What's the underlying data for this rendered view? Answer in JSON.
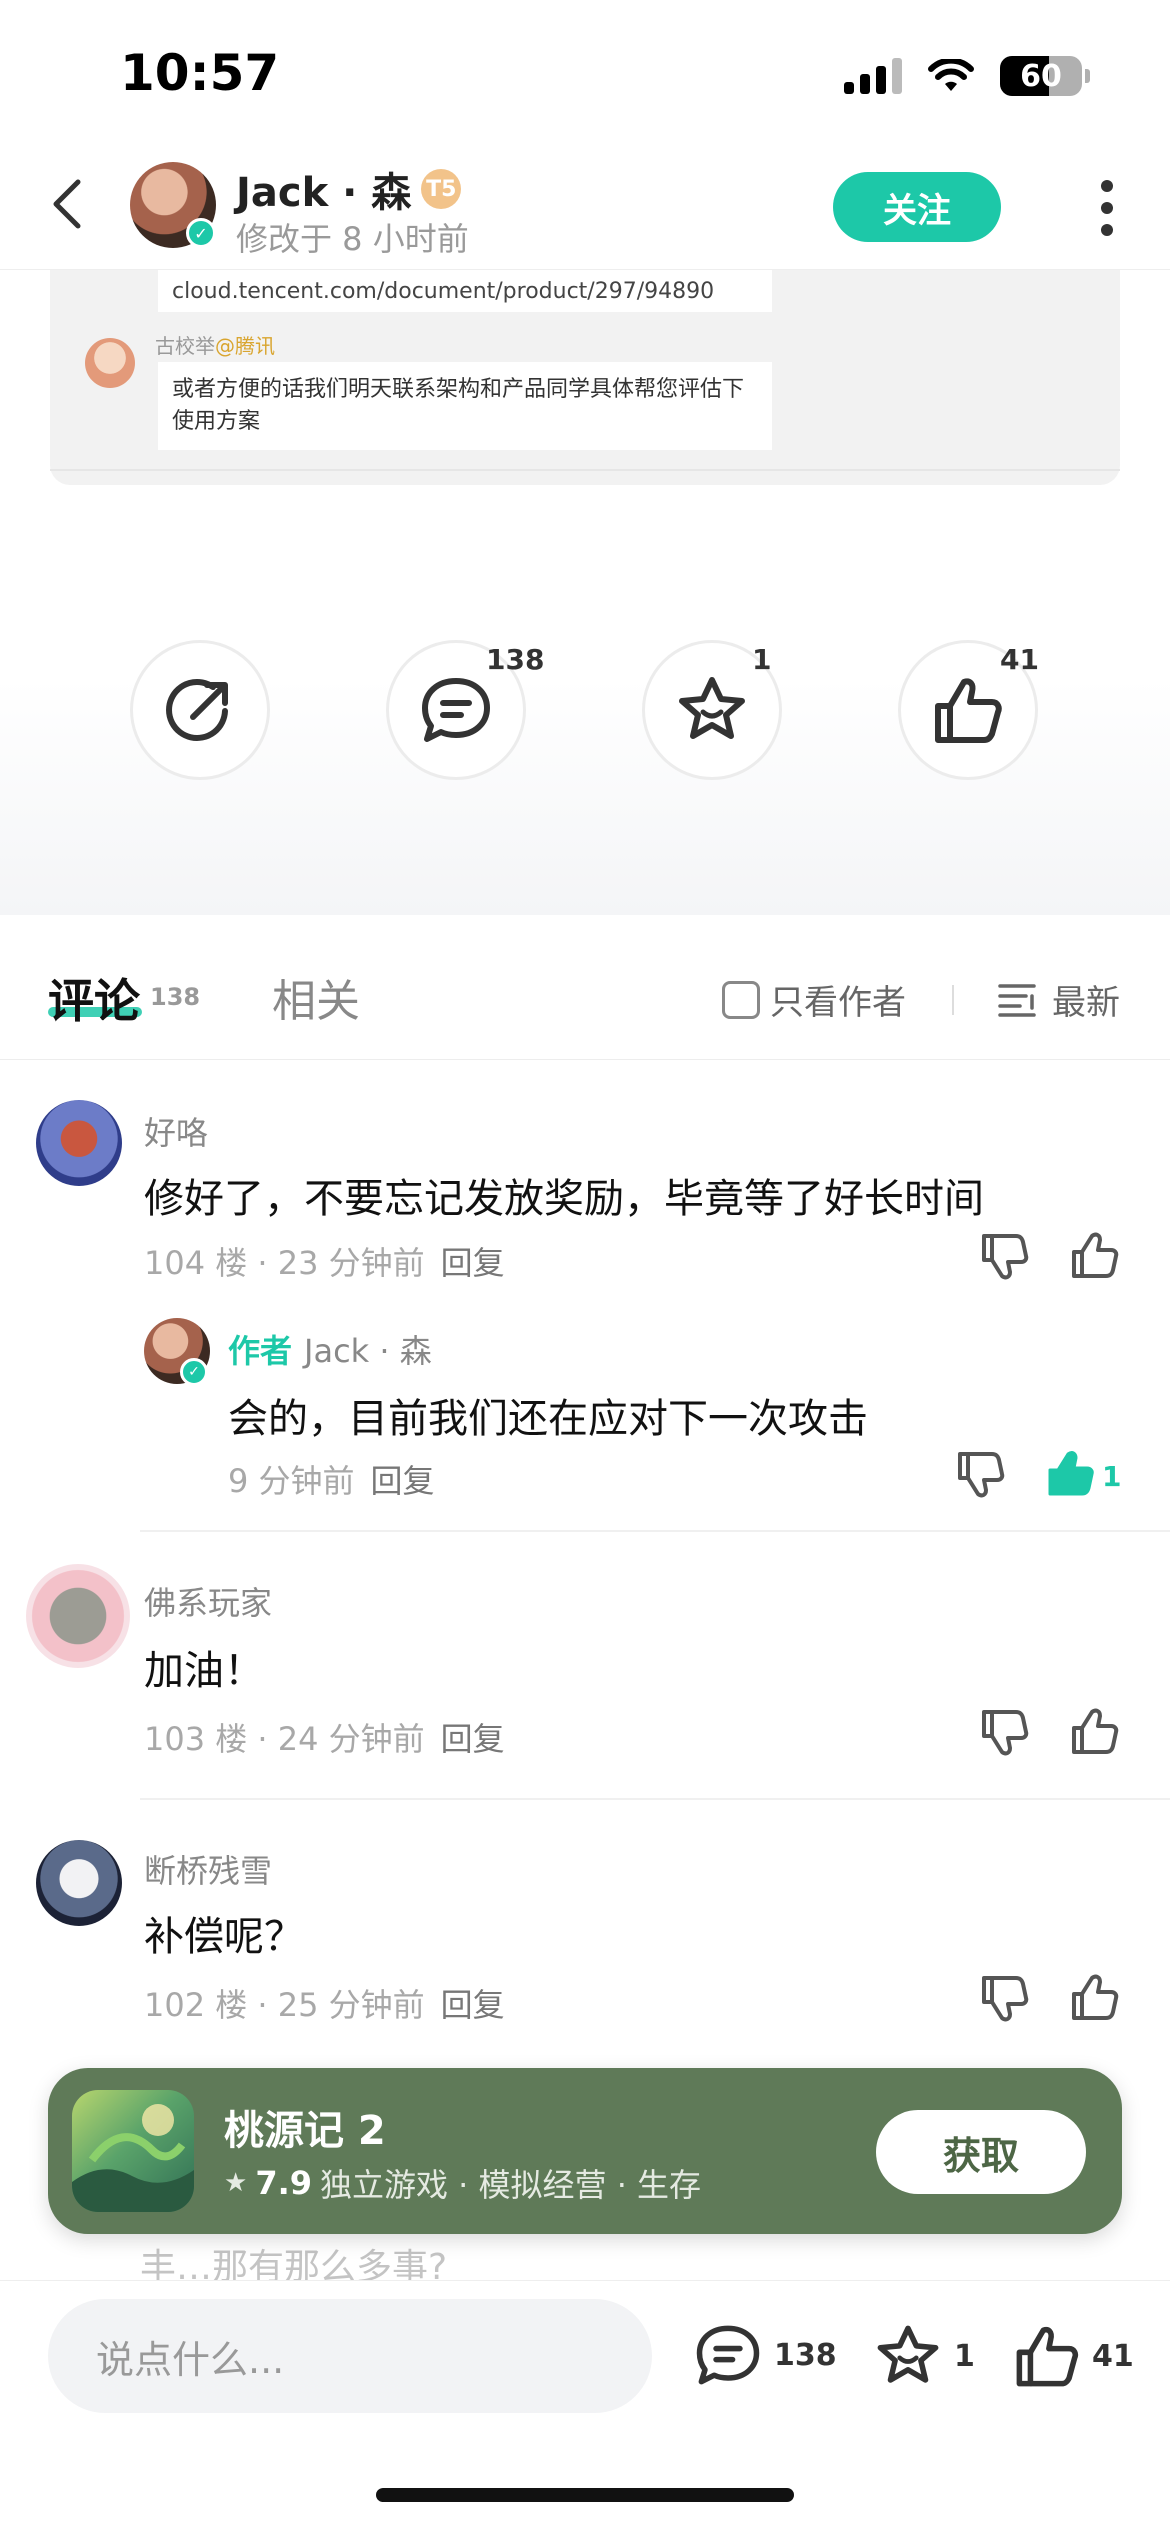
{
  "status_bar": {
    "time": "10:57",
    "battery": "60"
  },
  "header": {
    "author_name": "Jack · 森",
    "level_badge": "T5",
    "subtitle": "修改于 8 小时前",
    "follow_label": "关注"
  },
  "embed": {
    "link_text": "cloud.tencent.com/document/product/297/94890",
    "replier_name": "古校举",
    "replier_org": "@腾讯",
    "message": "或者方便的话我们明天联系架构和产品同学具体帮您评估下使用方案"
  },
  "actions": {
    "share": "",
    "comment_count": "138",
    "favorite_count": "1",
    "like_count": "41"
  },
  "tabs": {
    "comments_label": "评论",
    "comments_count": "138",
    "related_label": "相关",
    "only_author_label": "只看作者",
    "sort_label": "最新"
  },
  "comments": [
    {
      "name": "好咯",
      "text": "修好了，不要忘记发放奖励，毕竟等了好长时间",
      "meta": "104 楼 · 23 分钟前",
      "reply_label": "回复"
    },
    {
      "author_tag": "作者",
      "name": "Jack · 森",
      "text": "会的，目前我们还在应对下一次攻击",
      "meta": "9 分钟前",
      "reply_label": "回复",
      "like_count": "1"
    },
    {
      "name": "佛系玩家",
      "text": "加油！",
      "meta": "103 楼 · 24 分钟前",
      "reply_label": "回复"
    },
    {
      "name": "断桥残雪",
      "text": "补偿呢？",
      "meta": "102 楼 · 25 分钟前",
      "reply_label": "回复"
    }
  ],
  "peek_text": "丰…那有那么多事?",
  "promo": {
    "title": "桃源记 2",
    "rating": "7.9",
    "tags": "独立游戏 · 模拟经营 · 生存",
    "button_label": "获取"
  },
  "bottom_bar": {
    "input_placeholder": "说点什么...",
    "comment_count": "138",
    "favorite_count": "1",
    "like_count": "41"
  },
  "colors": {
    "accent": "#1dc8a8",
    "promo_bg": "#5f7a58"
  }
}
